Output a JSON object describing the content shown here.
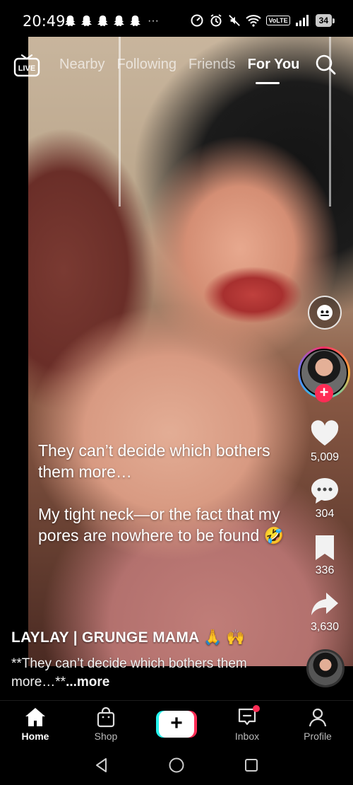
{
  "status_bar": {
    "time": "20:49",
    "more": "···",
    "volte": "VoLTE",
    "battery": "34"
  },
  "top_nav": {
    "live_label": "LIVE",
    "tabs": [
      "Nearby",
      "Following",
      "Friends",
      "For You"
    ],
    "active_tab": "For You"
  },
  "video": {
    "overlay_lines": [
      "They can’t decide which bothers them more…",
      "My tight neck—or the fact that my pores are nowhere to be found 🤣"
    ]
  },
  "right_rail": {
    "likes": "5,009",
    "comments": "304",
    "saves": "336",
    "shares": "3,630"
  },
  "post": {
    "author": "LAYLAY | GRUNGE MAMA 🙏 🙌",
    "description": "**They can’t decide which bothers them more…**",
    "more": "...more"
  },
  "bottom_nav": {
    "home": "Home",
    "shop": "Shop",
    "create": "+",
    "inbox": "Inbox",
    "profile": "Profile"
  },
  "colors": {
    "accent": "#fe2c55",
    "cyan": "#25f4ee"
  }
}
